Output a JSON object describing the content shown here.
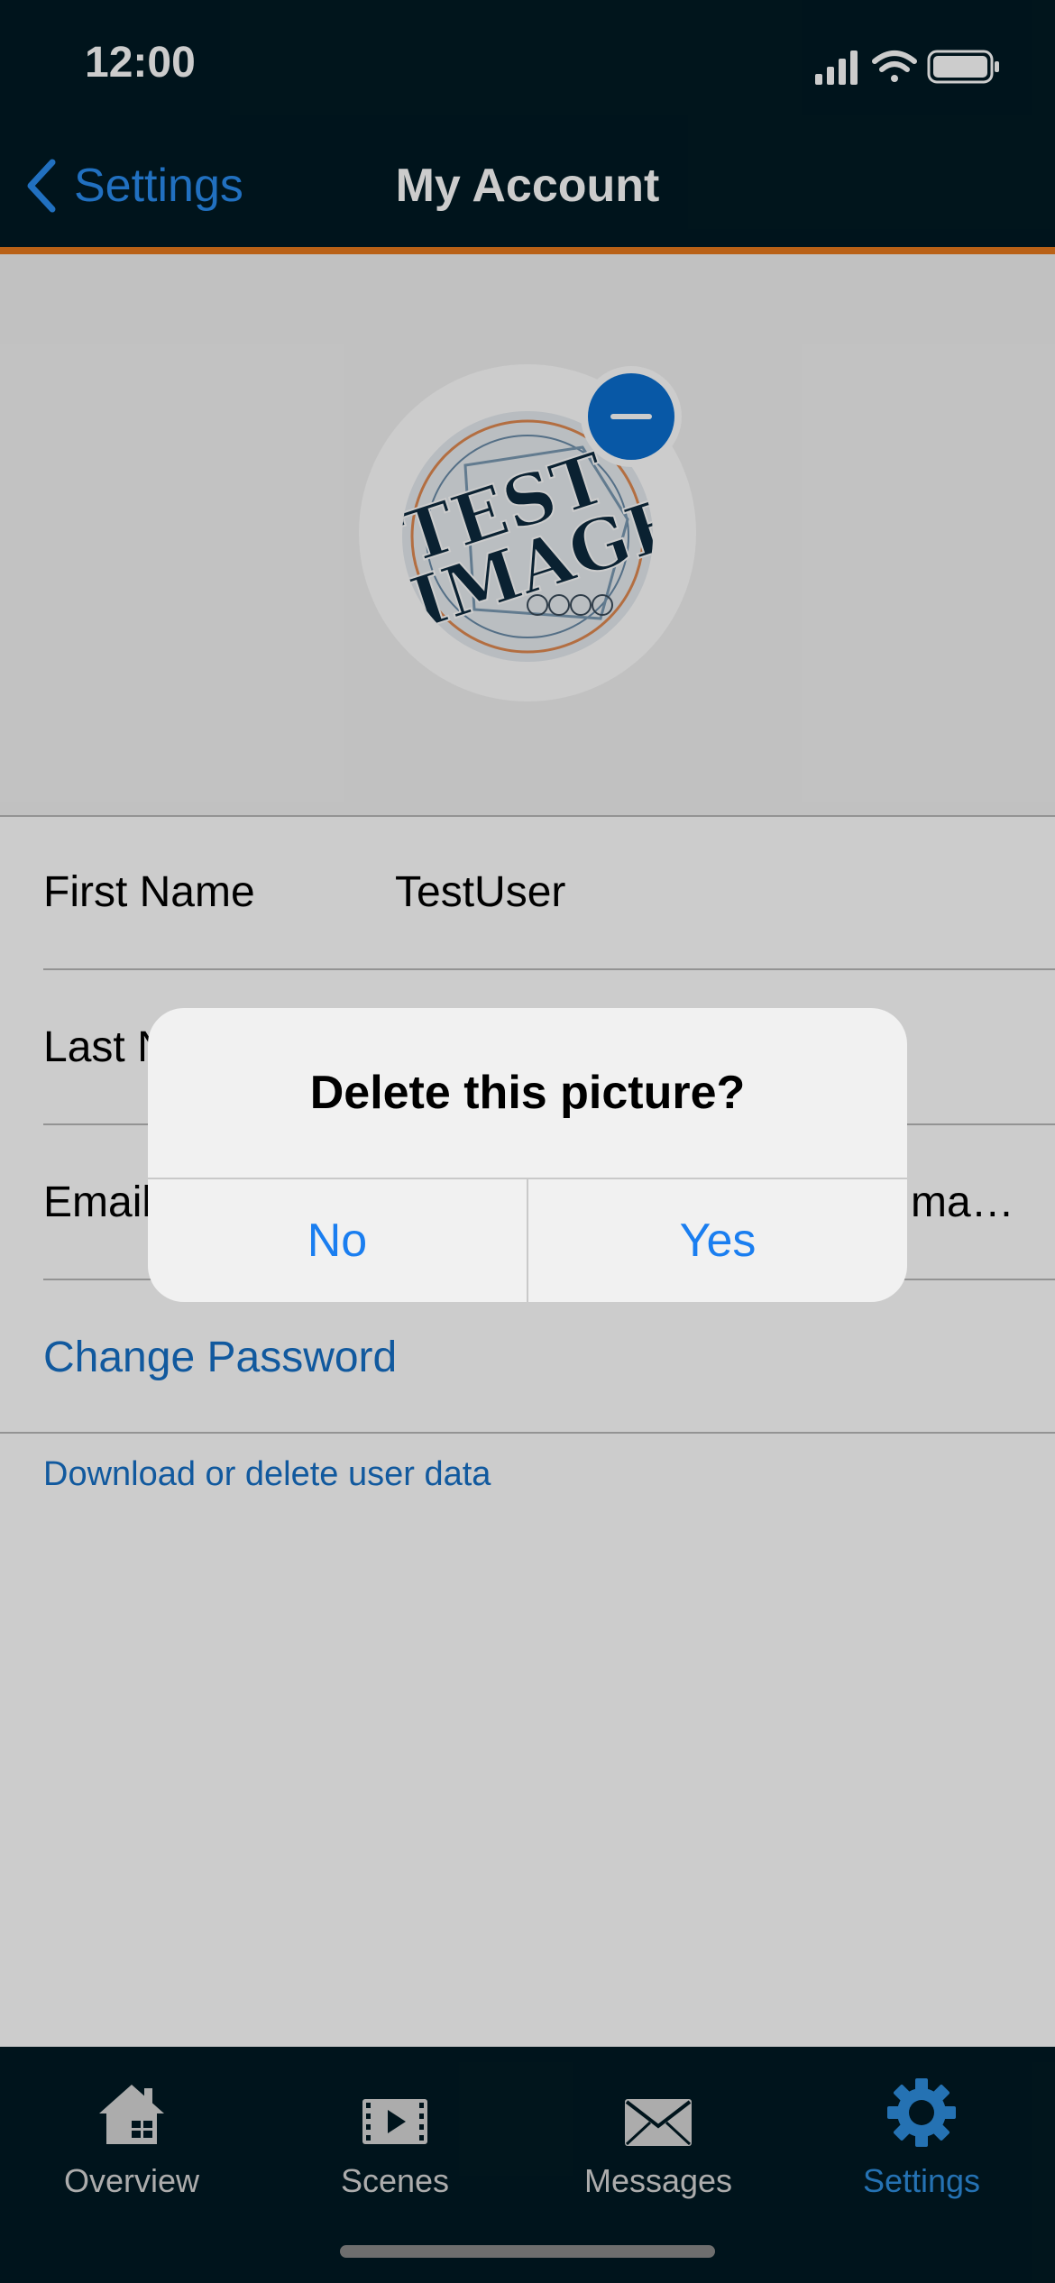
{
  "status_bar": {
    "time": "12:00"
  },
  "nav": {
    "back_label": "Settings",
    "title": "My Account"
  },
  "avatar": {
    "image_text_line1": "TEST",
    "image_text_line2": "IMAGE"
  },
  "form": {
    "first_name_label": "First Name",
    "first_name_value": "TestUser",
    "last_name_label": "Last N",
    "email_label": "Email",
    "email_value": "mai…"
  },
  "links": {
    "change_password": "Change Password",
    "download_delete": "Download or delete user data"
  },
  "alert": {
    "title": "Delete this picture?",
    "no_label": "No",
    "yes_label": "Yes"
  },
  "tabbar": {
    "tabs": [
      {
        "label": "Overview",
        "icon": "home-icon"
      },
      {
        "label": "Scenes",
        "icon": "scenes-icon"
      },
      {
        "label": "Messages",
        "icon": "envelope-icon"
      },
      {
        "label": "Settings",
        "icon": "gear-icon",
        "active": true
      }
    ]
  },
  "colors": {
    "accent": "#e87a1d",
    "link": "#1670c6",
    "header_bg": "#011a23",
    "active_tab": "#2f8fe0"
  }
}
